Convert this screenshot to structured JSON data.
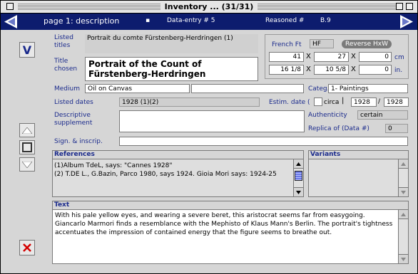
{
  "window": {
    "title": "Inventory ... (31/31)"
  },
  "nav": {
    "page_label": "page 1: description",
    "bullet": "▪",
    "data_entry": "Data-entry # 5",
    "reasoned_label": "Reasoned #",
    "reasoned_value": "B.9"
  },
  "fields": {
    "listed_titles_label": "Listed\ntitles",
    "listed_titles_l1": "Listed",
    "listed_titles_l2": "titles",
    "listed_titles_value": "Portrait du comte Fürstenberg-Herdringen (1)",
    "title_chosen_l1": "Title",
    "title_chosen_l2": "chosen",
    "title_chosen_line1": "Portrait of the Count of",
    "title_chosen_line2": "Fürstenberg-Herdringen",
    "medium_label": "Medium",
    "medium_value": "Oil on Canvas",
    "medium_extra": "",
    "categ_label": "Categ.",
    "categ_value": "1- Paintings",
    "listed_dates_label": "Listed dates",
    "listed_dates_value": "1928 (1)(2)",
    "estim_date_label": "Estim. date (",
    "circa_label": "circa",
    "estim_date_from": "1928",
    "estim_sep": "/",
    "estim_date_to": "1928",
    "descriptive_l1": "Descriptive",
    "descriptive_l2": "supplement",
    "descriptive_value": "",
    "authenticity_label": "Authenticity",
    "authenticity_value": "certain",
    "replica_label": "Replica of (Data #)",
    "replica_value": "0",
    "sign_label": "Sign. & inscrip.",
    "sign_value": ""
  },
  "dimensions": {
    "french_ft_label": "French Ft",
    "hf_value": "HF",
    "reverse_button": "Reverse HxW",
    "x": "X",
    "cm_row": [
      "41",
      "27",
      "0"
    ],
    "cm_unit": "cm",
    "in_row": [
      "16 1/8",
      "10 5/8",
      "0"
    ],
    "in_unit": "in."
  },
  "references": {
    "header": "References",
    "lines": [
      "(1)Album TdeL, says: \"Cannes 1928\"",
      "(2) T.DE L., G.Bazin, Parco 1980, says 1924. Gioia Mori says: 1924-25"
    ]
  },
  "variants": {
    "header": "Variants"
  },
  "text_panel": {
    "header": "Text",
    "body": "  With his pale yellow eyes, and wearing a severe beret, this aristocrat seems far from easygoing. Giancarlo Marmori finds a resemblance with the Mephisto of Klaus Mann's Berlin. The portrait's tightness accentuates the impression of contained energy that the figure seems to breathe out."
  },
  "colors": {
    "nav_bar": "#0d1c6e",
    "label_blue": "#1a2a8c",
    "delete_red": "#d40000"
  },
  "icons": [
    "close-box-icon",
    "zoom-box-icon",
    "collapse-box-icon",
    "prev-arrow-icon",
    "next-arrow-icon",
    "v-view-icon",
    "up-arrow-icon",
    "square-icon",
    "down-arrow-icon",
    "delete-x-icon",
    "scroll-up-icon",
    "scroll-down-icon"
  ]
}
